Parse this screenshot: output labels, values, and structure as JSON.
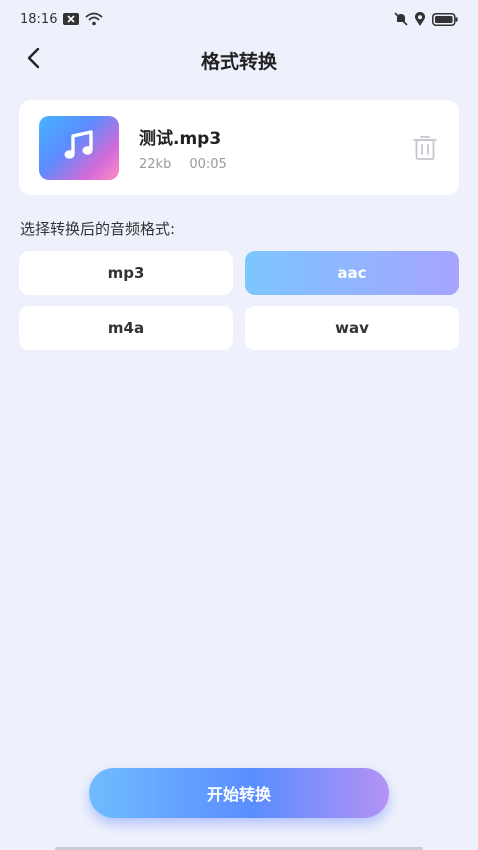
{
  "status_bar": {
    "time": "18:16"
  },
  "header": {
    "title": "格式转换"
  },
  "file": {
    "name": "测试.mp3",
    "size": "22kb",
    "duration": "00:05"
  },
  "format_section": {
    "label": "选择转换后的音频格式:",
    "options": [
      {
        "label": "mp3",
        "selected": false
      },
      {
        "label": "aac",
        "selected": true
      },
      {
        "label": "m4a",
        "selected": false
      },
      {
        "label": "wav",
        "selected": false
      }
    ]
  },
  "actions": {
    "start_label": "开始转换"
  },
  "colors": {
    "background": "#eef1fb",
    "accent_start": "#6fbcff",
    "accent_end": "#b592f5",
    "selected_option_start": "#7cc6ff",
    "selected_option_end": "#a6a4ff"
  }
}
